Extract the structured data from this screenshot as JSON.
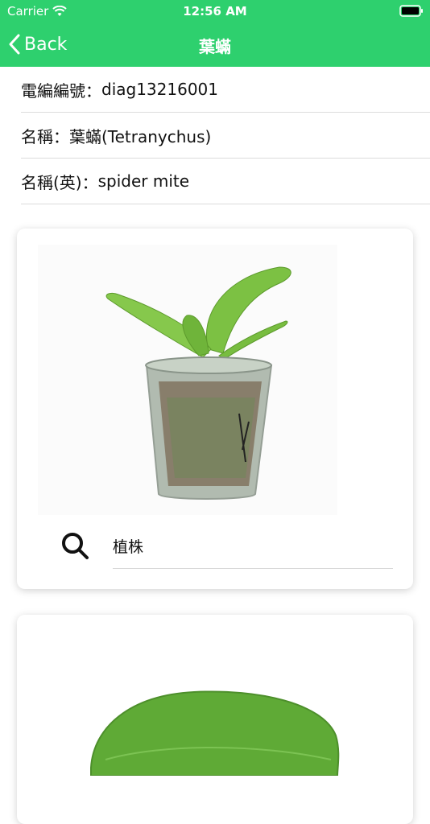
{
  "status": {
    "carrier": "Carrier",
    "time": "12:56 AM"
  },
  "nav": {
    "back_label": "Back",
    "title": "葉蟎"
  },
  "info": [
    {
      "label": "電編編號：",
      "value": "diag13216001"
    },
    {
      "label": "名稱：",
      "value": "葉蟎(Tetranychus)"
    },
    {
      "label": "名稱(英)：",
      "value": "spider mite"
    }
  ],
  "cards": [
    {
      "caption": "植株"
    }
  ],
  "colors": {
    "header": "#2ed06e",
    "text": "#111111"
  }
}
